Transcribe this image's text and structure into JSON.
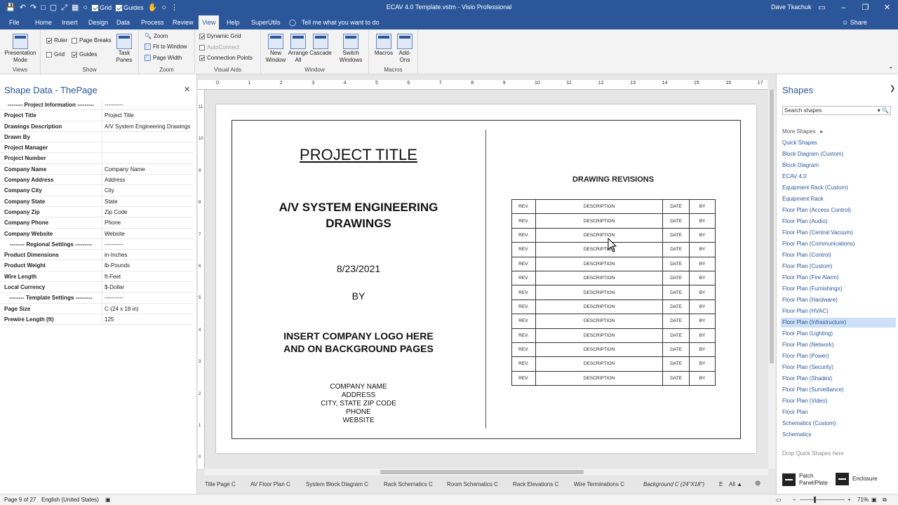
{
  "titlebar": {
    "title": "ECAV 4.0 Template.vstm  -  Visio Professional",
    "user": "Dave Tkachuk",
    "qat_grid": "Grid",
    "qat_guides": "Guides"
  },
  "tabs": [
    "File",
    "Home",
    "Insert",
    "Design",
    "Data",
    "Process",
    "Review",
    "View",
    "Help",
    "SuperUtils"
  ],
  "active_tab": "View",
  "tell_me": "Tell me what you want to do",
  "share": "Share",
  "ribbon": {
    "views": {
      "presentation": "Presentation Mode",
      "label": "Views"
    },
    "show": {
      "ruler": "Ruler",
      "page_breaks": "Page Breaks",
      "grid": "Grid",
      "guides": "Guides",
      "task_panes": "Task Panes",
      "label": "Show"
    },
    "zoom": {
      "zoom": "Zoom",
      "fit": "Fit to Window",
      "page_width": "Page Width",
      "label": "Zoom"
    },
    "visual_aids": {
      "dynamic_grid": "Dynamic Grid",
      "autoconnect": "AutoConnect",
      "connection_points": "Connection Points",
      "label": "Visual Aids"
    },
    "window": {
      "new_window": "New Window",
      "arrange_all": "Arrange All",
      "cascade": "Cascade",
      "switch_windows": "Switch Windows",
      "label": "Window"
    },
    "macros": {
      "macros": "Macros",
      "addons": "Add-Ons",
      "label": "Macros"
    }
  },
  "shape_data": {
    "title": "Shape Data - ThePage",
    "rows": [
      {
        "k": "-------- Project Information ---------",
        "v": "----------",
        "section": true
      },
      {
        "k": "Project Title",
        "v": "Project Title"
      },
      {
        "k": "Drawings Description",
        "v": "A/V System Engineering Drawings"
      },
      {
        "k": "Drawn By",
        "v": ""
      },
      {
        "k": "Project Manager",
        "v": ""
      },
      {
        "k": "Project Number",
        "v": ""
      },
      {
        "k": "Company Name",
        "v": "Company Name"
      },
      {
        "k": "Company Address",
        "v": "Address"
      },
      {
        "k": "Company City",
        "v": "City"
      },
      {
        "k": "Company State",
        "v": "State"
      },
      {
        "k": "Company Zip",
        "v": "Zip Code"
      },
      {
        "k": "Company Phone",
        "v": "Phone"
      },
      {
        "k": "Company Website",
        "v": "Website"
      },
      {
        "k": "-------- Regional Settings ---------",
        "v": "----------",
        "section": true
      },
      {
        "k": "Product Dimensions",
        "v": "in-Inches"
      },
      {
        "k": "Product Weight",
        "v": "lb-Pounds"
      },
      {
        "k": "Wire Length",
        "v": "ft-Feet"
      },
      {
        "k": "Local Currency",
        "v": "$-Dollar"
      },
      {
        "k": "-------- Template Settings ---------",
        "v": "----------",
        "section": true
      },
      {
        "k": "Page Size",
        "v": "C-(24 x 18 in)"
      },
      {
        "k": "Prewire Length (ft)",
        "v": "125"
      }
    ]
  },
  "drawing": {
    "project_title": "PROJECT TITLE",
    "description_line1": "A/V SYSTEM ENGINEERING",
    "description_line2": "DRAWINGS",
    "date": "8/23/2021",
    "by": "BY",
    "logo_line1": "INSERT COMPANY LOGO HERE",
    "logo_line2": "AND ON BACKGROUND PAGES",
    "company_lines": [
      "COMPANY NAME",
      "ADDRESS",
      "CITY, STATE  ZIP CODE",
      "PHONE",
      "WEBSITE"
    ],
    "revisions_title": "DRAWING REVISIONS",
    "revision_row": [
      "REV.",
      "DESCRIPTION",
      "DATE",
      "BY"
    ],
    "revision_row_count": 13
  },
  "ruler_numbers": [
    "0",
    "1",
    "2",
    "3",
    "4",
    "5",
    "6",
    "7",
    "8",
    "9",
    "10",
    "11",
    "12",
    "13",
    "14",
    "15",
    "16",
    "17"
  ],
  "vruler_numbers": [
    "11",
    "10",
    "9",
    "8",
    "7",
    "6",
    "5",
    "4",
    "3",
    "2",
    "1",
    "0"
  ],
  "page_tabs": [
    "Title Page C",
    "AV Floor Plan C",
    "System Block Diagram C",
    "Rack Schematics C",
    "Room Schematics C",
    "Rack Elevations C",
    "Wire Terminations C",
    "Background C (24\"X18\")",
    "E",
    "All"
  ],
  "shapes_panel": {
    "title": "Shapes",
    "search_placeholder": "Search shapes",
    "more_shapes": "More Shapes",
    "stencils": [
      "Quick Shapes",
      "Block Diagram (Custom)",
      "Block Diagram",
      "ECAV 4.0",
      "Equipment Rack (Custom)",
      "Equipment Rack",
      "Floor Plan (Access Control)",
      "Floor Plan (Audio)",
      "Floor Plan (Central Vacuum)",
      "Floor Plan (Communications)",
      "Floor Plan (Control)",
      "Floor Plan (Custom)",
      "Floor Plan (Fire Alarm)",
      "Floor Plan (Furnishings)",
      "Floor Plan (Hardware)",
      "Floor Plan (HVAC)",
      "Floor Plan (Infrastructure)",
      "Floor Plan (Lighting)",
      "Floor Plan (Network)",
      "Floor Plan (Power)",
      "Floor Plan (Security)",
      "Floor Plan (Shades)",
      "Floor Plan (Surveillance)",
      "Floor Plan (Video)",
      "Floor Plan",
      "Schematics (Custom)",
      "Schematics"
    ],
    "selected_stencil": "Floor Plan (Infrastructure)",
    "drop_hint": "Drop Quick Shapes here",
    "quick_shapes": [
      "Patch Panel/Plate",
      "Enclosure"
    ]
  },
  "status": {
    "page": "Page 9 of 27",
    "language": "English (United States)",
    "zoom": "71%"
  }
}
